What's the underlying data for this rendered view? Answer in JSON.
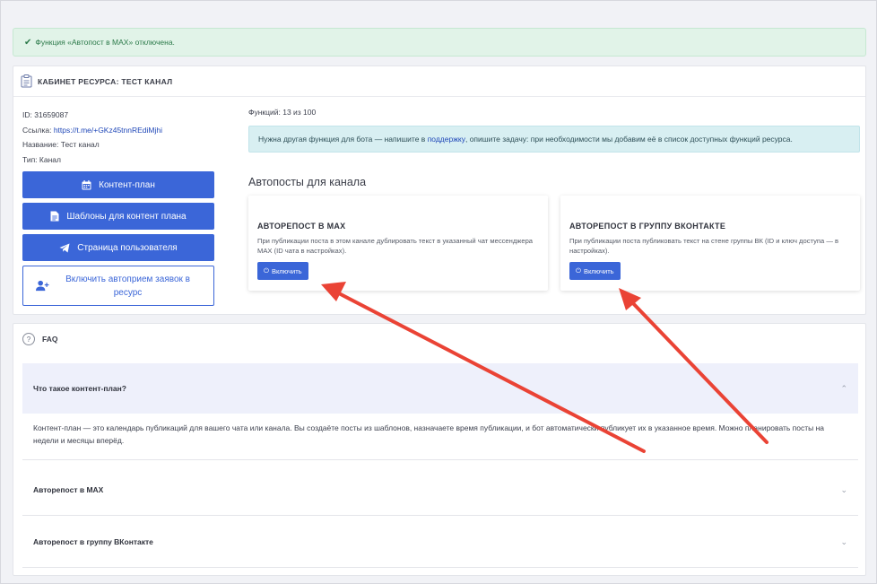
{
  "alert": {
    "icon": "check-icon",
    "text": "Функция «Автопост в MAX» отключена."
  },
  "resource": {
    "header_title": "КАБИНЕТ РЕСУРСА: ТЕСТ КАНАЛ",
    "id_label": "ID:",
    "id_value": "31659087",
    "link_label": "Ссылка:",
    "link_value": "https://t.me/+GKz45tnnREdiMjhi",
    "name_label": "Название:",
    "name_value": "Тест канал",
    "type_label": "Тип:",
    "type_value": "Канал"
  },
  "buttons": {
    "content_plan": "Контент-план",
    "templates": "Шаблоны для контент плана",
    "user_page": "Страница пользователя",
    "auto_accept": "Включить автоприем заявок в ресурс"
  },
  "functions": {
    "count_label": "Функций: 13 из 100",
    "info_prefix": "Нужна другая функция для бота — напишите в ",
    "info_link": "поддержку",
    "info_suffix": ", опишите задачу: при необходимости мы добавим её в список доступных функций ресурса."
  },
  "autoposts": {
    "section_title": "Автопосты для канала",
    "cards": [
      {
        "title": "АВТОРЕПОСТ В MAX",
        "desc": "При публикации поста в этом канале дублировать текст в указанный чат мессенджера MAX (ID чата в настройках).",
        "button": "Включить"
      },
      {
        "title": "АВТОРЕПОСТ В ГРУППУ ВКОНТАКТЕ",
        "desc": "При публикации поста публиковать текст на стене группы ВК (ID и ключ доступа — в настройках).",
        "button": "Включить"
      }
    ]
  },
  "faq": {
    "title": "FAQ",
    "items": [
      {
        "q": "Что такое контент-план?",
        "a": "Контент-план — это календарь публикаций для вашего чата или канала. Вы создаёте посты из шаблонов, назначаете время публикации, и бот автоматически публикует их в указанное время. Можно планировать посты на недели и месяцы вперёд."
      },
      {
        "q": "Авторепост в MAX"
      },
      {
        "q": "Авторепост в группу ВКонтакте"
      }
    ]
  },
  "colors": {
    "primary": "#3b66d8",
    "annotation_arrow": "#ea4335",
    "success_bg": "#e1f3e8",
    "info_bg": "#d8eff2"
  }
}
